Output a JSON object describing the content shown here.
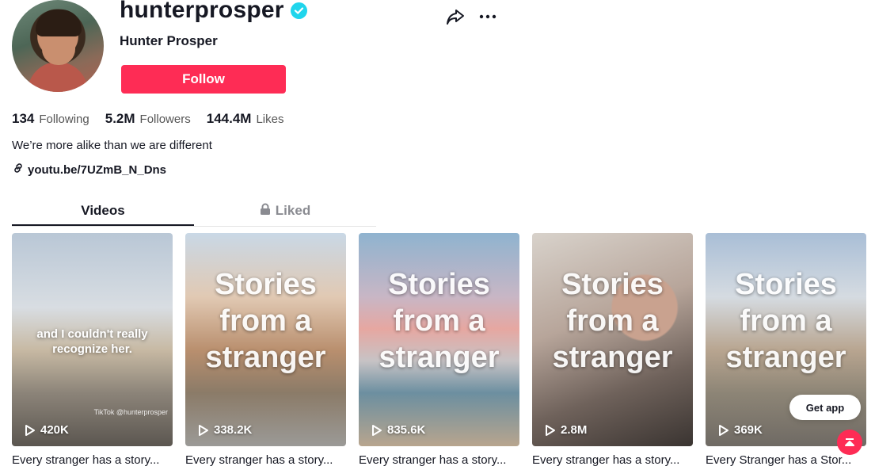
{
  "profile": {
    "username": "hunterprosper",
    "nickname": "Hunter Prosper",
    "follow_label": "Follow",
    "bio": "We’re more alike than we are different",
    "link": "youtu.be/7UZmB_N_Dns"
  },
  "stats": [
    {
      "value": "134",
      "label": "Following"
    },
    {
      "value": "5.2M",
      "label": "Followers"
    },
    {
      "value": "144.4M",
      "label": "Likes"
    }
  ],
  "tabs": [
    {
      "label": "Videos",
      "active": true
    },
    {
      "label": "Liked",
      "active": false,
      "icon": "lock-icon"
    }
  ],
  "videos": [
    {
      "overlay": "and I couldn't really recognize her.",
      "views": "420K",
      "caption": "Every stranger has a story...",
      "watermark": "TikTok @hunterprosper"
    },
    {
      "overlay": "Stories from a stranger",
      "views": "338.2K",
      "caption": "Every stranger has a story..."
    },
    {
      "overlay": "Stories from a stranger",
      "views": "835.6K",
      "caption": "Every stranger has a story..."
    },
    {
      "overlay": "Stories from a stranger",
      "views": "2.8M",
      "caption": "Every stranger has a story..."
    },
    {
      "overlay": "Stories from a stranger",
      "views": "369K",
      "caption": "Every Stranger has a Stor..."
    }
  ],
  "get_app_label": "Get app",
  "colors": {
    "accent": "#fe2c55",
    "verified": "#20d5ec",
    "text": "#161823"
  }
}
